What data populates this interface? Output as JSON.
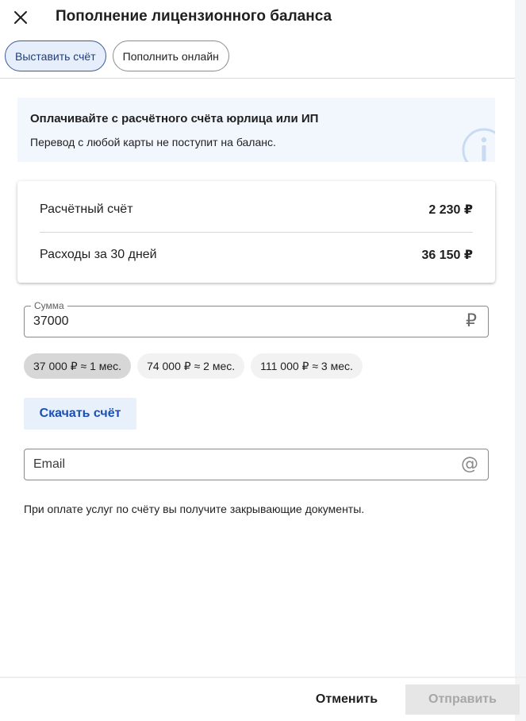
{
  "header": {
    "title": "Пополнение лицензионного баланса",
    "close_icon": "close-icon"
  },
  "tabs": [
    {
      "label": "Выставить счёт",
      "active": true
    },
    {
      "label": "Пополнить онлайн",
      "active": false
    }
  ],
  "banner": {
    "title": "Оплачивайте с расчётного счёта юрлица или ИП",
    "text": "Перевод с любой карты не поступит на баланс.",
    "icon": "info-icon"
  },
  "balance_card": {
    "rows": [
      {
        "label": "Расчётный счёт",
        "value": "2 230 ₽"
      },
      {
        "label": "Расходы за 30 дней",
        "value": "36 150 ₽"
      }
    ]
  },
  "amount_field": {
    "label": "Сумма",
    "value": "37000",
    "suffix": "₽"
  },
  "amount_chips": [
    {
      "label": "37 000 ₽ ≈ 1 мес.",
      "selected": true
    },
    {
      "label": "74 000 ₽ ≈ 2 мес.",
      "selected": false
    },
    {
      "label": "111 000 ₽ ≈ 3 мес.",
      "selected": false
    }
  ],
  "download_button": {
    "label": "Скачать счёт"
  },
  "email_field": {
    "placeholder": "Email",
    "value": "",
    "suffix": "@"
  },
  "note": "При оплате услуг по счёту вы получите закрывающие документы.",
  "footer": {
    "cancel_label": "Отменить",
    "submit_label": "Отправить",
    "submit_disabled": true
  },
  "colors": {
    "accent": "#1a4fb5",
    "active_tab_bg": "#e6eefb",
    "banner_bg": "#f2f6fd",
    "disabled_bg": "#e6e6e6"
  }
}
